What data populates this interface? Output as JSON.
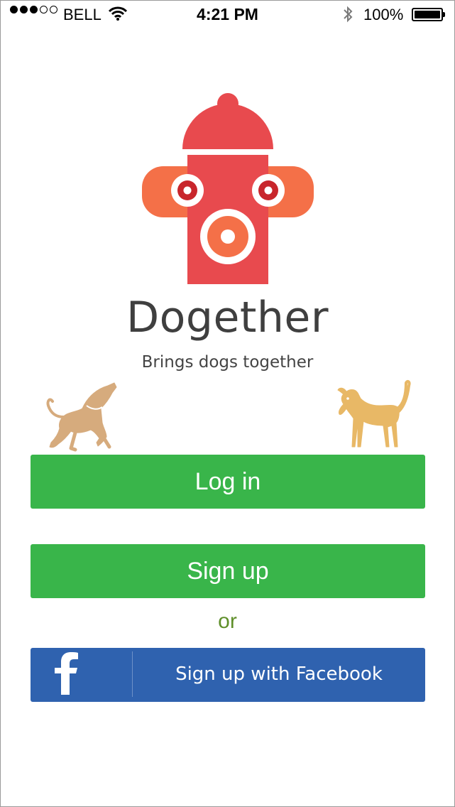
{
  "status_bar": {
    "signal_full": 3,
    "signal_empty": 2,
    "carrier": "BELL",
    "time": "4:21 PM",
    "battery_percent": "100%",
    "battery_level": 1.0,
    "icons": [
      "wifi-icon",
      "bluetooth-icon",
      "battery-icon"
    ]
  },
  "app": {
    "name": "Dogether",
    "tagline": "Brings dogs together",
    "logo_icon": "fire-hydrant-icon",
    "logo_colors": {
      "body": "#e84a4e",
      "side": "#f47048",
      "accent": "#c8262c"
    }
  },
  "illustrations": {
    "left": "dog-howling-icon",
    "right": "dog-standing-icon",
    "left_color": "#d6ab7d",
    "right_color": "#e8b866"
  },
  "actions": {
    "login_label": "Log in",
    "signup_label": "Sign up",
    "or_label": "or",
    "facebook_label": "Sign up with Facebook",
    "facebook_icon": "facebook-icon",
    "green": "#39b54a",
    "facebook_blue": "#2f62af"
  }
}
